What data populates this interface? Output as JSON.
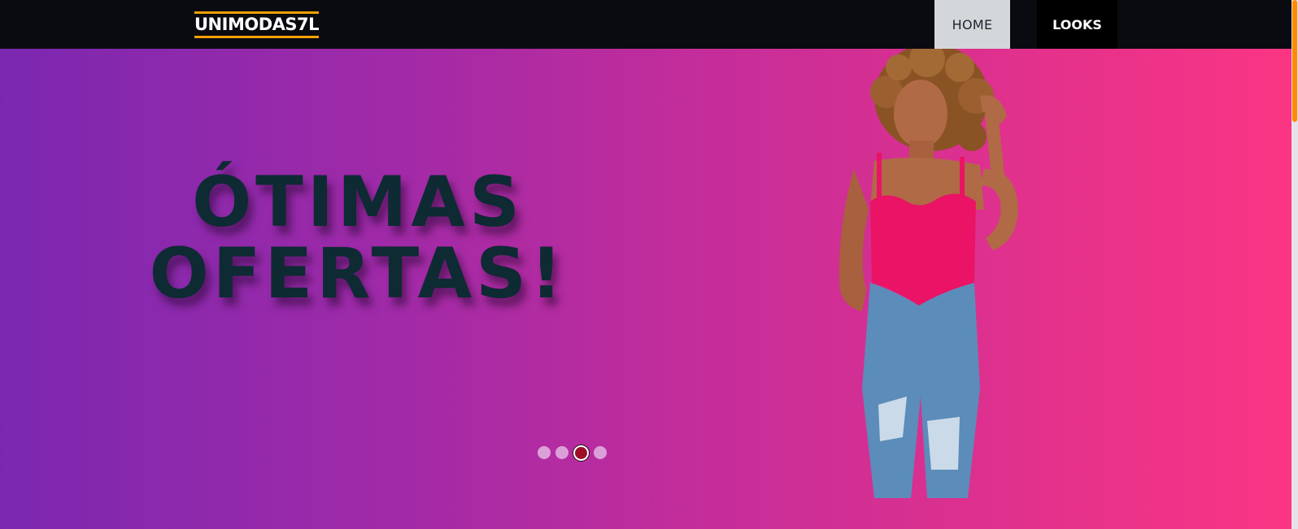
{
  "brand": {
    "logo": "UNIMODAS7L",
    "accent": "#f5a000"
  },
  "nav": {
    "items": [
      {
        "label": "HOME",
        "active": true
      },
      {
        "label": "LOOKS",
        "active": false
      }
    ]
  },
  "hero": {
    "headline_line1": "ÓTIMAS",
    "headline_line2": "OFERTAS!",
    "gradient_start": "#7b28b0",
    "gradient_end": "#fb3584",
    "slider": {
      "total_slides": 4,
      "active_index": 2
    }
  }
}
